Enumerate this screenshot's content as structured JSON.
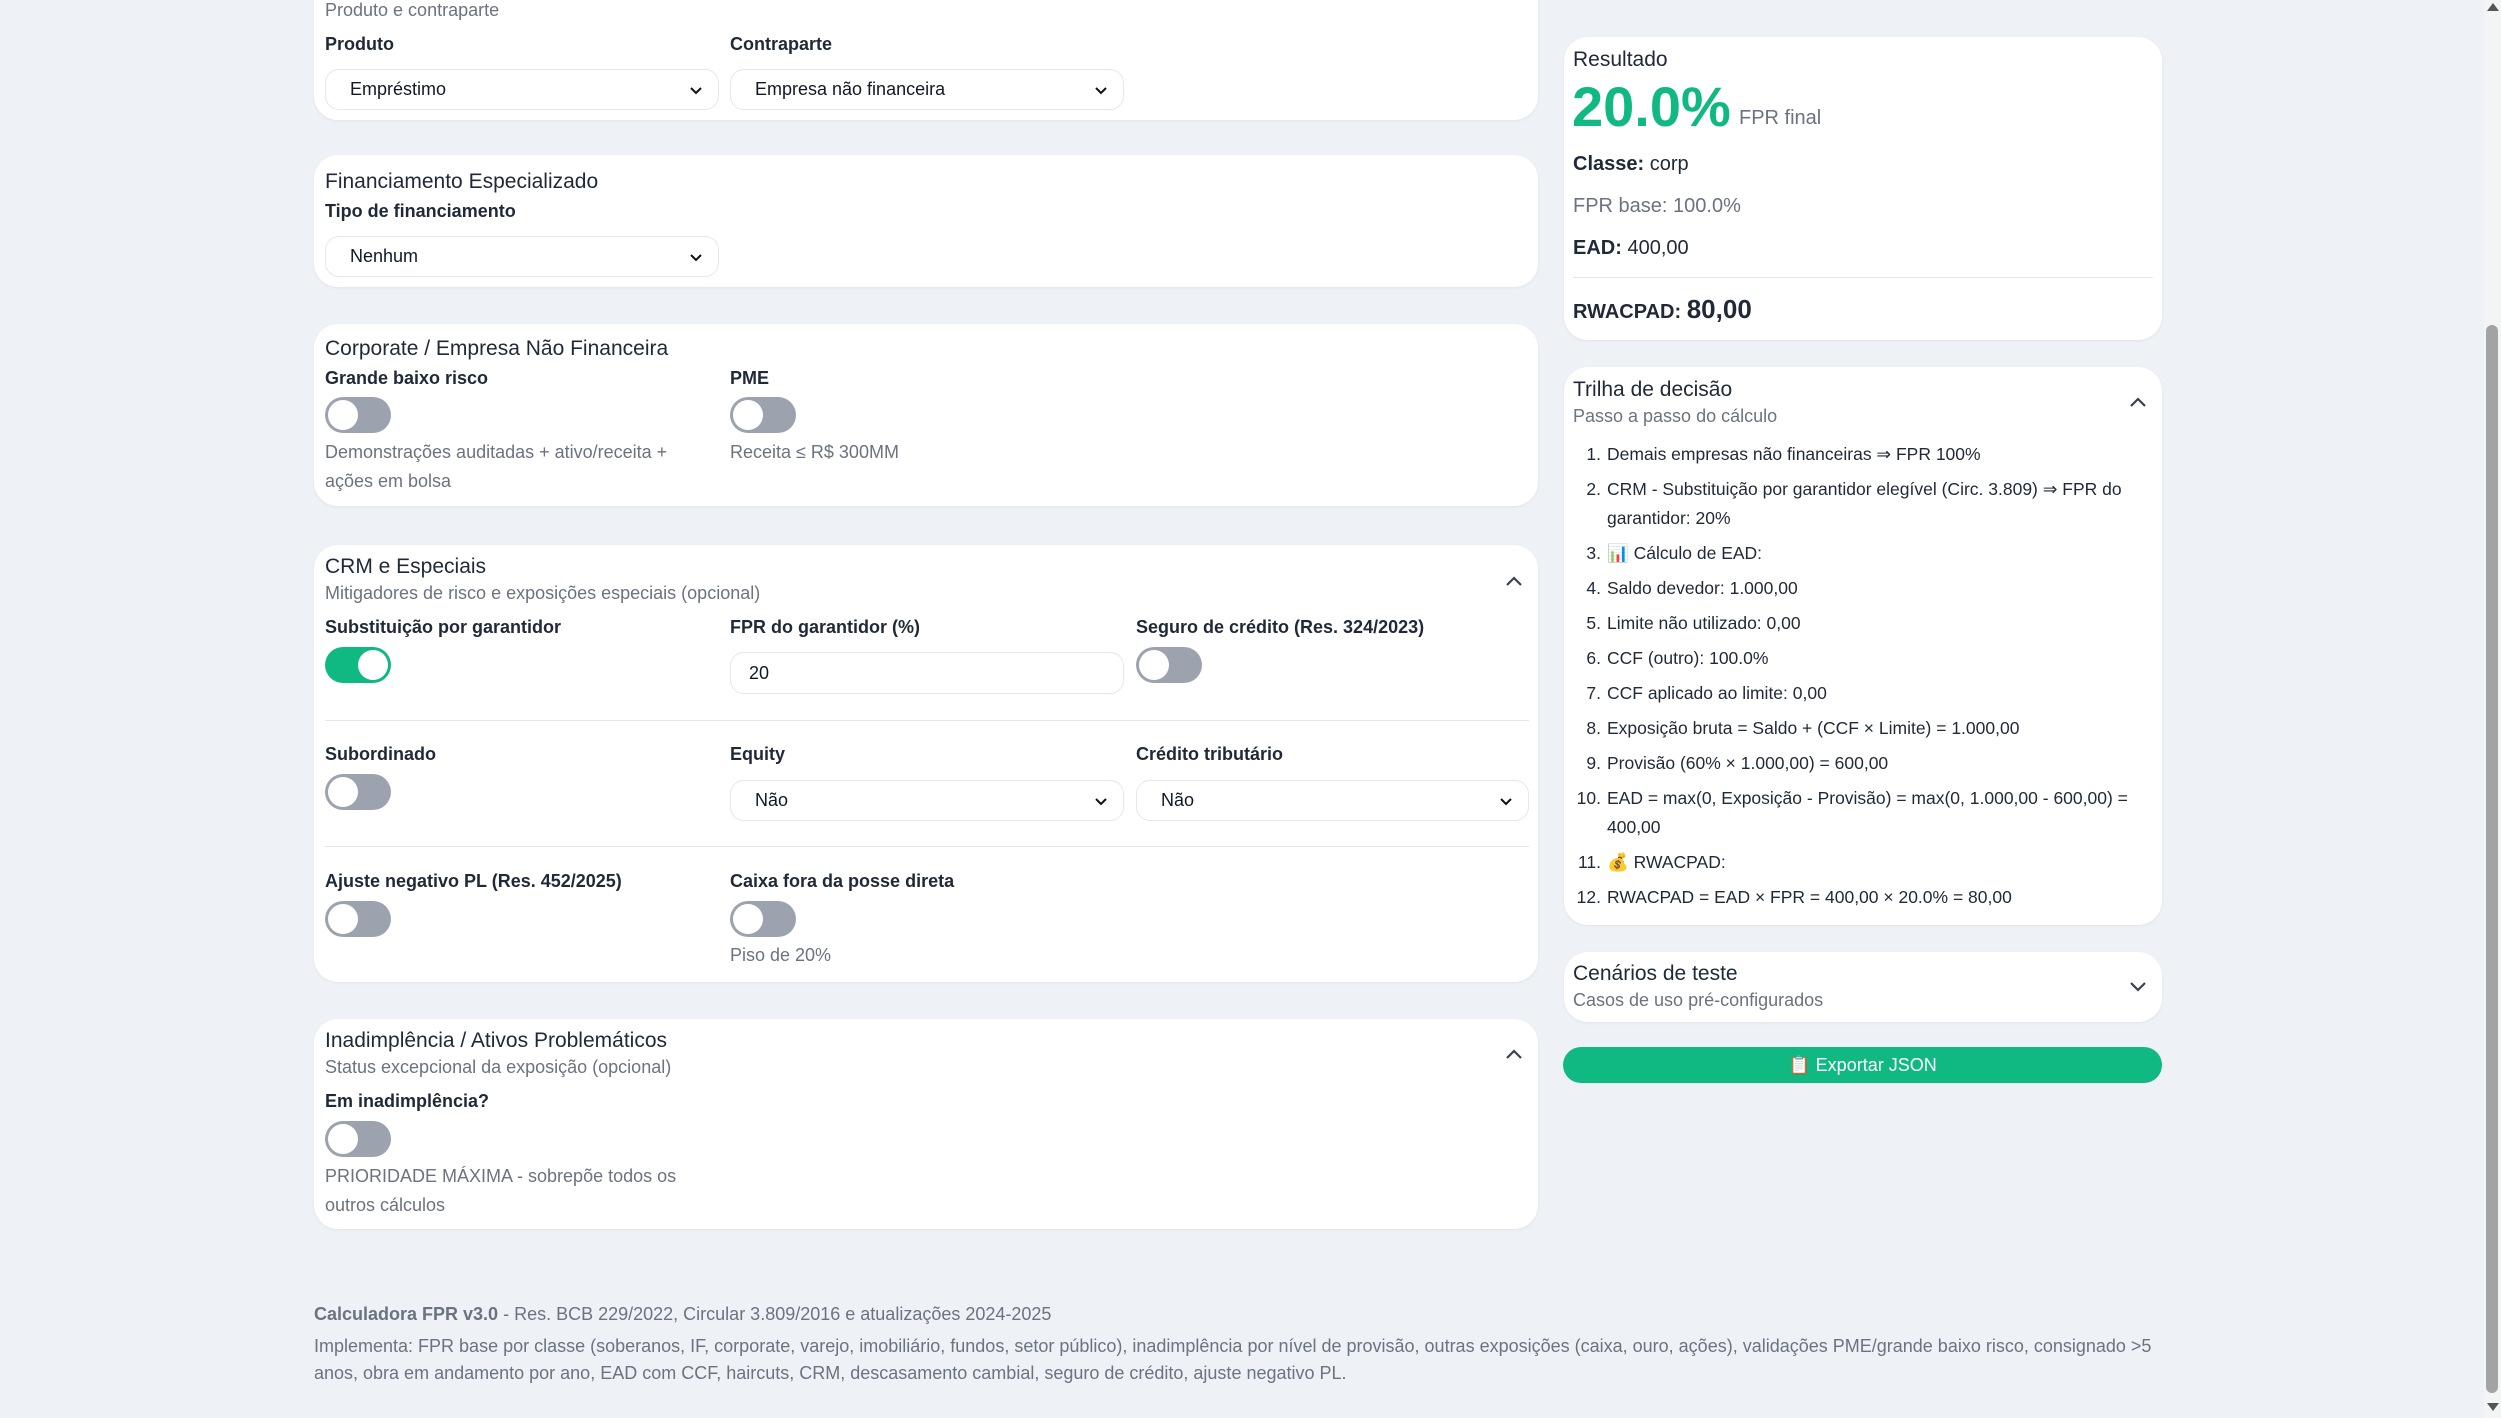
{
  "top": {
    "section_sub": "Produto e contraparte",
    "produto_label": "Produto",
    "produto_value": "Empréstimo",
    "contraparte_label": "Contraparte",
    "contraparte_value": "Empresa não financeira"
  },
  "financiamento": {
    "title": "Financiamento Especializado",
    "tipo_label": "Tipo de financiamento",
    "tipo_value": "Nenhum"
  },
  "corporate": {
    "title": "Corporate / Empresa Não Financeira",
    "grande_label": "Grande baixo risco",
    "grande_on": false,
    "grande_help": "Demonstrações auditadas + ativo/receita + ações em bolsa",
    "pme_label": "PME",
    "pme_on": false,
    "pme_help": "Receita ≤ R$ 300MM"
  },
  "crm": {
    "title": "CRM e Especiais",
    "subtitle": "Mitigadores de risco e exposições especiais (opcional)",
    "subst_label": "Substituição por garantidor",
    "subst_on": true,
    "fpr_gar_label": "FPR do garantidor (%)",
    "fpr_gar_value": "20",
    "seguro_label": "Seguro de crédito (Res. 324/2023)",
    "seguro_on": false,
    "subordinado_label": "Subordinado",
    "subordinado_on": false,
    "equity_label": "Equity",
    "equity_value": "Não",
    "credito_label": "Crédito tributário",
    "credito_value": "Não",
    "ajuste_label": "Ajuste negativo PL (Res. 452/2025)",
    "ajuste_on": false,
    "caixa_label": "Caixa fora da posse direta",
    "caixa_on": false,
    "caixa_help": "Piso de 20%"
  },
  "inadimplencia": {
    "title": "Inadimplência / Ativos Problemáticos",
    "subtitle": "Status excepcional da exposição (opcional)",
    "label": "Em inadimplência?",
    "on": false,
    "help": "PRIORIDADE MÁXIMA - sobrepõe todos os outros cálculos"
  },
  "resultado": {
    "title": "Resultado",
    "fpr_value": "20.0%",
    "fpr_caption": "FPR final",
    "classe_label": "Classe:",
    "classe_value": "corp",
    "fpr_base": "FPR base: 100.0%",
    "ead_label": "EAD:",
    "ead_value": "400,00",
    "rwacpad_label": "RWACPAD:",
    "rwacpad_value": "80,00",
    "accent_color": "#10b981"
  },
  "trilha": {
    "title": "Trilha de decisão",
    "subtitle": "Passo a passo do cálculo",
    "steps": [
      {
        "n": "1.",
        "text": "Demais empresas não financeiras ⇒ FPR 100%"
      },
      {
        "n": "2.",
        "text": "CRM - Substituição por garantidor elegível (Circ. 3.809) ⇒ FPR do garantidor: 20%"
      },
      {
        "n": "3.",
        "text": "📊 Cálculo de EAD:"
      },
      {
        "n": "4.",
        "text": "Saldo devedor: 1.000,00"
      },
      {
        "n": "5.",
        "text": "Limite não utilizado: 0,00"
      },
      {
        "n": "6.",
        "text": "CCF (outro): 100.0%"
      },
      {
        "n": "7.",
        "text": "CCF aplicado ao limite: 0,00"
      },
      {
        "n": "8.",
        "text": "Exposição bruta = Saldo + (CCF × Limite) = 1.000,00"
      },
      {
        "n": "9.",
        "text": "Provisão (60% × 1.000,00) = 600,00"
      },
      {
        "n": "10.",
        "text": "EAD = max(0, Exposição - Provisão) = max(0, 1.000,00 - 600,00) = 400,00"
      },
      {
        "n": "11.",
        "text": "💰 RWACPAD:"
      },
      {
        "n": "12.",
        "text": "RWACPAD = EAD × FPR = 400,00 × 20.0% = 80,00"
      }
    ]
  },
  "cenarios": {
    "title": "Cenários de teste",
    "subtitle": "Casos de uso pré-configurados"
  },
  "export_label": "📋 Exportar JSON",
  "footer": {
    "version": "Calculadora FPR v3.0",
    "version_rest": " - Res. BCB 229/2022, Circular 3.809/2016 e atualizações 2024-2025",
    "implementa": "Implementa: FPR base por classe (soberanos, IF, corporate, varejo, imobiliário, fundos, setor público), inadimplência por nível de provisão, outras exposições (caixa, ouro, ações), validações PME/grande baixo risco, consignado >5 anos, obra em andamento por ano, EAD com CCF, haircuts, CRM, descasamento cambial, seguro de crédito, ajuste negativo PL."
  }
}
